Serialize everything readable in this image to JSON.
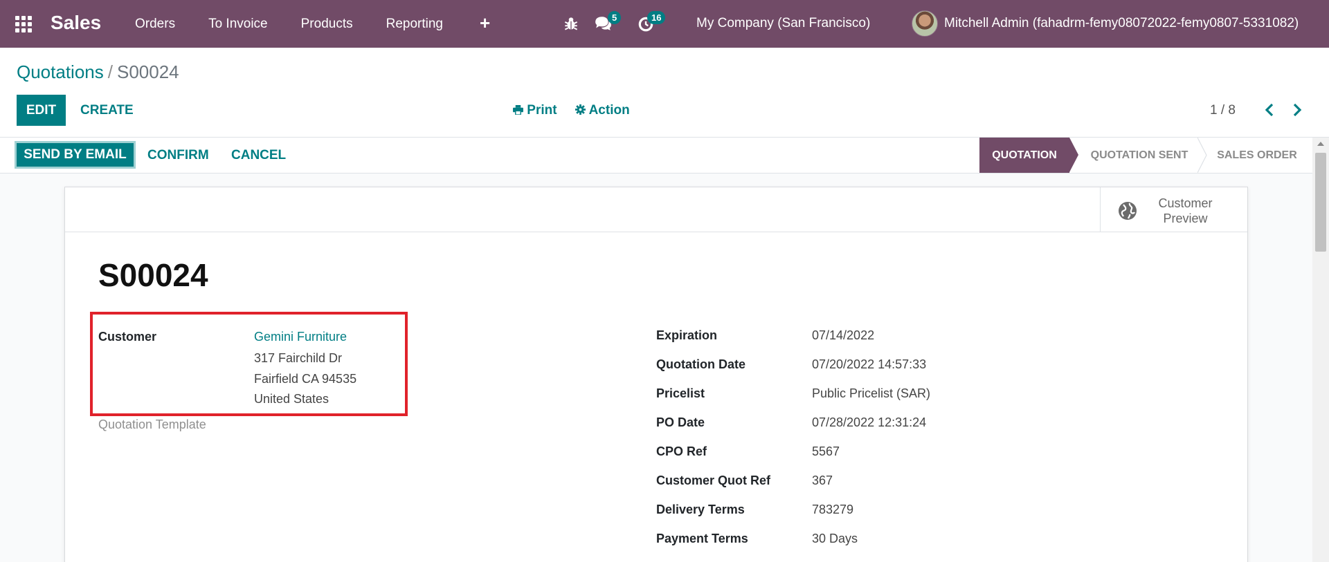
{
  "navbar": {
    "brand": "Sales",
    "menu": [
      "Orders",
      "To Invoice",
      "Products",
      "Reporting"
    ],
    "plus": "+",
    "chat_count": "5",
    "activity_count": "16",
    "company": "My Company (San Francisco)",
    "user": "Mitchell Admin (fahadrm-femy08072022-femy0807-5331082)",
    "bar_color": "#714b67"
  },
  "control_panel": {
    "breadcrumb_parent": "Quotations",
    "breadcrumb_sep": "/",
    "breadcrumb_current": "S00024",
    "edit_label": "EDIT",
    "create_label": "CREATE",
    "print_label": "Print",
    "action_label": "Action",
    "pager": "1 / 8",
    "accent": "#017e84"
  },
  "statusbar": {
    "send_label": "SEND BY EMAIL",
    "confirm_label": "CONFIRM",
    "cancel_label": "CANCEL",
    "stages": [
      "QUOTATION",
      "QUOTATION SENT",
      "SALES ORDER"
    ],
    "active_stage": "QUOTATION"
  },
  "form": {
    "preview_line1": "Customer",
    "preview_line2": "Preview",
    "name": "S00024",
    "customer_label": "Customer",
    "customer_name": "Gemini Furniture",
    "address_line1": "317 Fairchild Dr",
    "address_line2": "Fairfield CA 94535",
    "address_line3": "United States",
    "template_label": "Quotation Template",
    "right_fields": [
      {
        "label": "Expiration",
        "value": "07/14/2022"
      },
      {
        "label": "Quotation Date",
        "value": "07/20/2022 14:57:33"
      },
      {
        "label": "Pricelist",
        "value": "Public Pricelist (SAR)"
      },
      {
        "label": "PO Date",
        "value": "07/28/2022 12:31:24"
      },
      {
        "label": "CPO Ref",
        "value": "5567"
      },
      {
        "label": "Customer Quot Ref",
        "value": "367"
      },
      {
        "label": "Delivery Terms",
        "value": "783279"
      },
      {
        "label": "Payment Terms",
        "value": "30 Days"
      }
    ],
    "highlight_color": "#e0222b"
  }
}
